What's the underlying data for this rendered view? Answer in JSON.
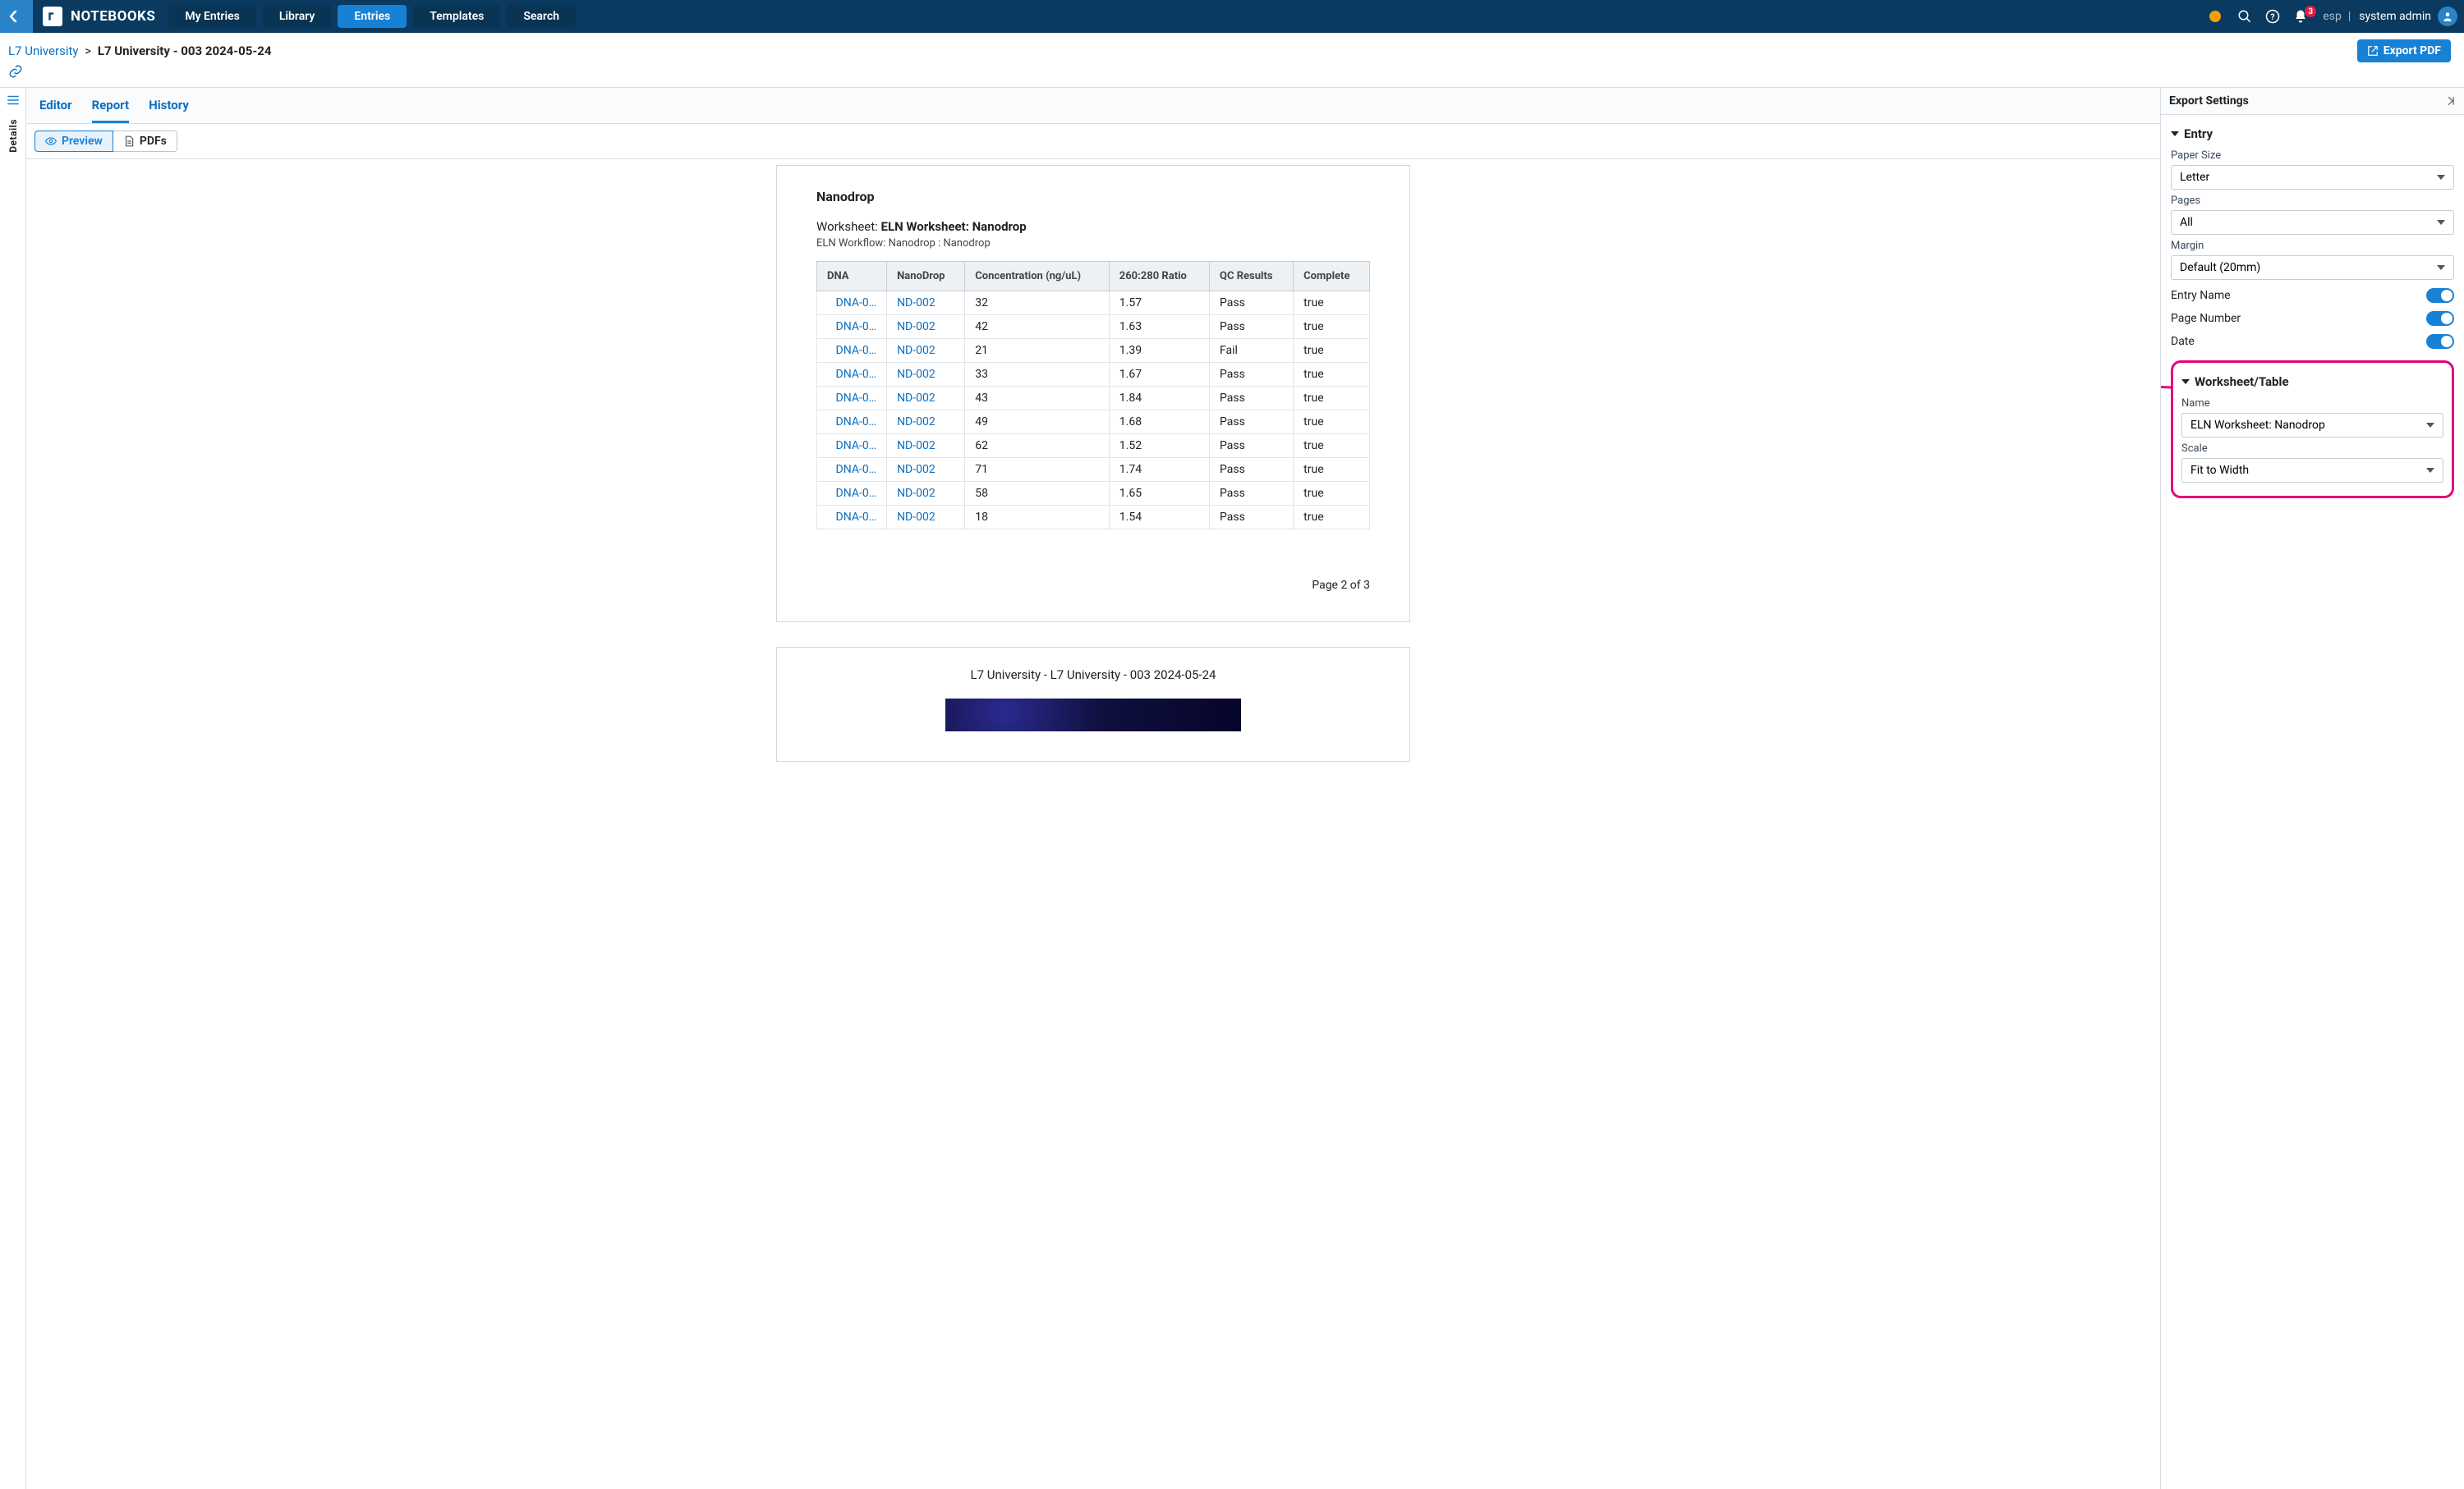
{
  "topbar": {
    "brand": "NOTEBOOKS",
    "nav": {
      "my_entries": "My Entries",
      "library": "Library",
      "entries": "Entries",
      "templates": "Templates",
      "search": "Search"
    },
    "badge_count": "3",
    "esp_label": "esp",
    "user_name": "system admin"
  },
  "breadcrumb": {
    "root": "L7 University",
    "sep": ">",
    "current": "L7 University - 003 2024-05-24",
    "export_btn": "Export PDF"
  },
  "rail": {
    "label": "Details"
  },
  "view_tabs": {
    "editor": "Editor",
    "report": "Report",
    "history": "History"
  },
  "subbar": {
    "preview": "Preview",
    "pdfs": "PDFs"
  },
  "report": {
    "section_title": "Nanodrop",
    "ws_label": "Worksheet:",
    "ws_name": "ELN Worksheet: Nanodrop",
    "ws_sub": "ELN Workflow: Nanodrop : Nanodrop",
    "columns": [
      "DNA",
      "NanoDrop",
      "Concentration (ng/uL)",
      "260:280 Ratio",
      "QC Results",
      "Complete"
    ],
    "rows": [
      {
        "dna": "DNA-0…",
        "nano": "ND-002",
        "conc": "32",
        "ratio": "1.57",
        "qc": "Pass",
        "done": "true"
      },
      {
        "dna": "DNA-0…",
        "nano": "ND-002",
        "conc": "42",
        "ratio": "1.63",
        "qc": "Pass",
        "done": "true"
      },
      {
        "dna": "DNA-0…",
        "nano": "ND-002",
        "conc": "21",
        "ratio": "1.39",
        "qc": "Fail",
        "done": "true"
      },
      {
        "dna": "DNA-0…",
        "nano": "ND-002",
        "conc": "33",
        "ratio": "1.67",
        "qc": "Pass",
        "done": "true"
      },
      {
        "dna": "DNA-0…",
        "nano": "ND-002",
        "conc": "43",
        "ratio": "1.84",
        "qc": "Pass",
        "done": "true"
      },
      {
        "dna": "DNA-0…",
        "nano": "ND-002",
        "conc": "49",
        "ratio": "1.68",
        "qc": "Pass",
        "done": "true"
      },
      {
        "dna": "DNA-0…",
        "nano": "ND-002",
        "conc": "62",
        "ratio": "1.52",
        "qc": "Pass",
        "done": "true"
      },
      {
        "dna": "DNA-0…",
        "nano": "ND-002",
        "conc": "71",
        "ratio": "1.74",
        "qc": "Pass",
        "done": "true"
      },
      {
        "dna": "DNA-0…",
        "nano": "ND-002",
        "conc": "58",
        "ratio": "1.65",
        "qc": "Pass",
        "done": "true"
      },
      {
        "dna": "DNA-0…",
        "nano": "ND-002",
        "conc": "18",
        "ratio": "1.54",
        "qc": "Pass",
        "done": "true"
      }
    ],
    "page_footer": "Page 2 of 3",
    "next_page_header": "L7 University - L7 University - 003 2024-05-24"
  },
  "panel": {
    "title": "Export Settings",
    "entry_section": "Entry",
    "paper_size_label": "Paper Size",
    "paper_size_value": "Letter",
    "pages_label": "Pages",
    "pages_value": "All",
    "margin_label": "Margin",
    "margin_value": "Default (20mm)",
    "toggle_entry_name": "Entry Name",
    "toggle_page_number": "Page Number",
    "toggle_date": "Date",
    "ws_section": "Worksheet/Table",
    "name_label": "Name",
    "name_value": "ELN Worksheet: Nanodrop",
    "scale_label": "Scale",
    "scale_value": "Fit to Width"
  },
  "annotation": {
    "color": "#e6007e"
  }
}
